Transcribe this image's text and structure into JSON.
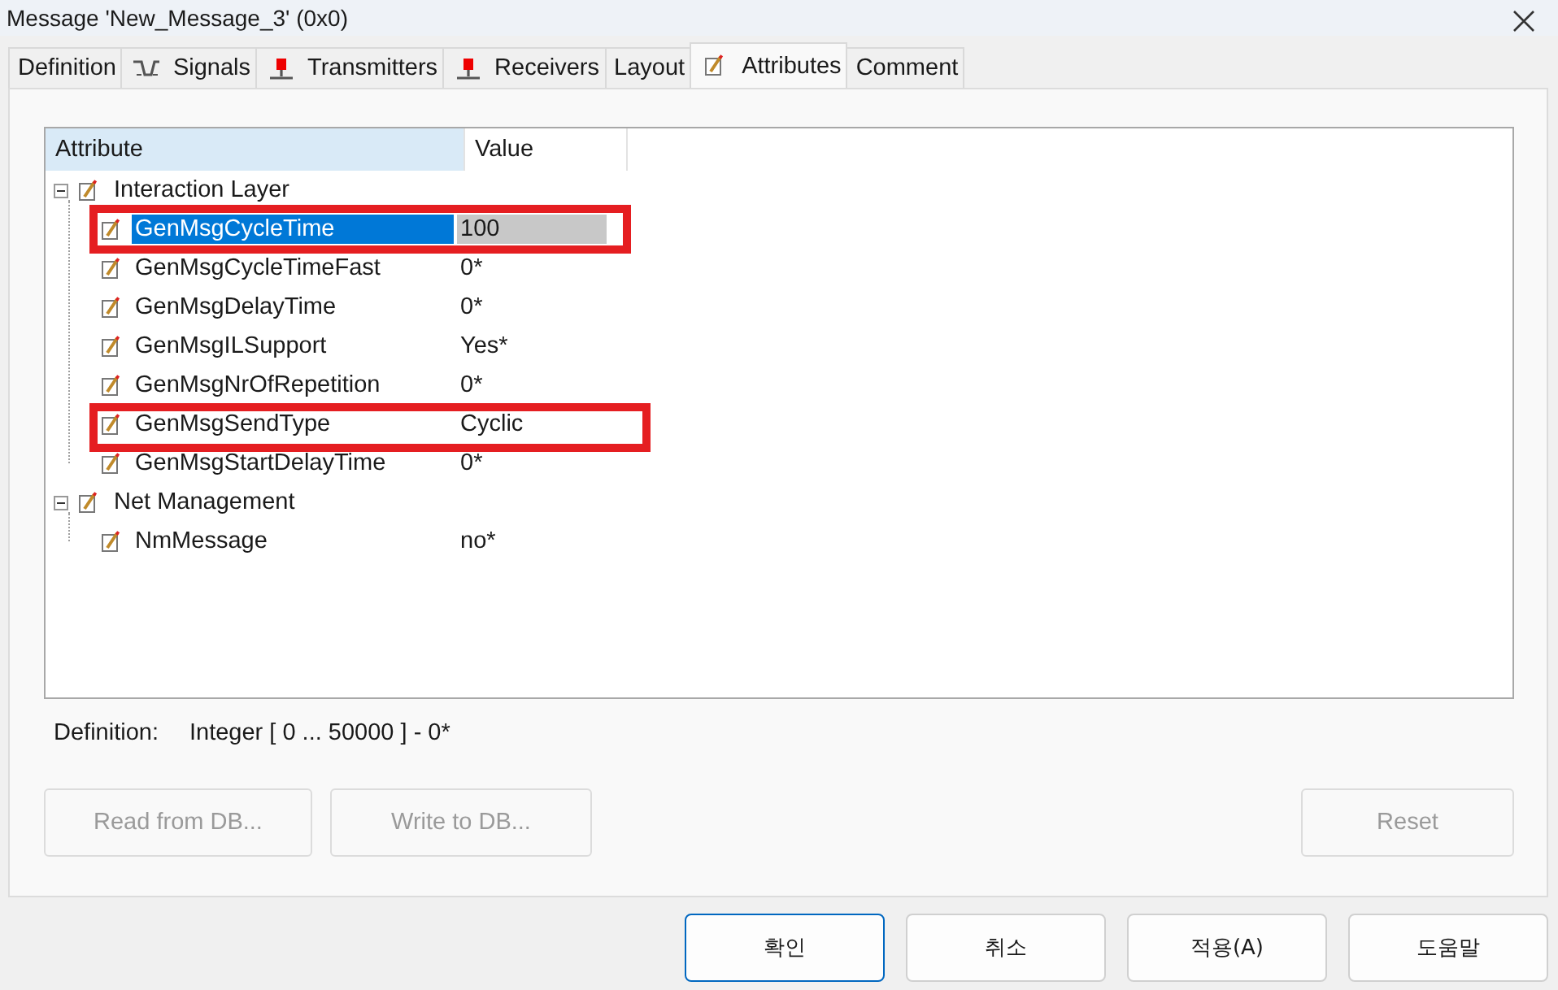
{
  "window": {
    "title": "Message 'New_Message_3' (0x0)"
  },
  "tabs": [
    {
      "label": "Definition",
      "kind": "plain",
      "selected": false
    },
    {
      "label": "Signals",
      "kind": "wave",
      "selected": false
    },
    {
      "label": "Transmitters",
      "kind": "node",
      "selected": false
    },
    {
      "label": "Receivers",
      "kind": "node",
      "selected": false
    },
    {
      "label": "Layout",
      "kind": "plain",
      "selected": false
    },
    {
      "label": "Attributes",
      "kind": "pencil",
      "selected": true
    },
    {
      "label": "Comment",
      "kind": "plain",
      "selected": false
    }
  ],
  "tree": {
    "columns": [
      "Attribute",
      "Value"
    ],
    "rows": [
      {
        "name": "Interaction Layer",
        "expanded": true,
        "children": [
          {
            "name": "GenMsgCycleTime",
            "value": "100",
            "selected": true,
            "editing": true,
            "highlighted": true
          },
          {
            "name": "GenMsgCycleTimeFast",
            "value": "0*",
            "selected": false,
            "editing": false,
            "highlighted": false
          },
          {
            "name": "GenMsgDelayTime",
            "value": "0*",
            "selected": false,
            "editing": false,
            "highlighted": false
          },
          {
            "name": "GenMsgILSupport",
            "value": "Yes*",
            "selected": false,
            "editing": false,
            "highlighted": false
          },
          {
            "name": "GenMsgNrOfRepetition",
            "value": "0*",
            "selected": false,
            "editing": false,
            "highlighted": false
          },
          {
            "name": "GenMsgSendType",
            "value": "Cyclic",
            "selected": false,
            "editing": true,
            "highlighted": true
          },
          {
            "name": "GenMsgStartDelayTime",
            "value": "0*",
            "selected": false,
            "editing": false,
            "highlighted": false
          }
        ]
      },
      {
        "name": "Net Management",
        "expanded": true,
        "children": [
          {
            "name": "NmMessage",
            "value": "no*",
            "selected": false,
            "editing": false,
            "highlighted": false
          }
        ]
      }
    ]
  },
  "definition": {
    "label": "Definition:",
    "value": "Integer [ 0 ... 50000 ] - 0*"
  },
  "panel_buttons": [
    {
      "label": "Read from DB...",
      "disabled": true
    },
    {
      "label": "Write to DB...",
      "disabled": true
    },
    {
      "label": "Reset",
      "disabled": true
    }
  ],
  "dialog_buttons": [
    {
      "label": "확인",
      "default": true
    },
    {
      "label": "취소",
      "default": false
    },
    {
      "label": "적용(A)",
      "default": false
    },
    {
      "label": "도움말",
      "default": false
    }
  ]
}
